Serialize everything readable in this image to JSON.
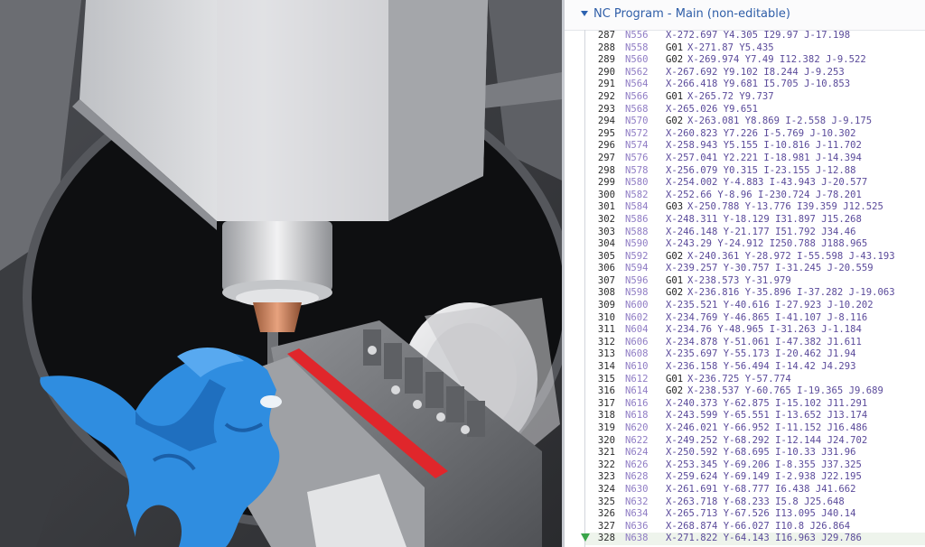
{
  "panel": {
    "title": "NC Program - Main (non-editable)",
    "current_line": "328"
  },
  "colors": {
    "part": "#2f8de0",
    "vise_stripe": "#e0262b",
    "tool_holder": "#c97a52",
    "tool_tip": "#e6c43a",
    "line_number_text": "#2b2b2b",
    "block_number_text": "#8f7cc4",
    "gcode_text": "#222222",
    "coord_text": "#5a4a9a",
    "header_text": "#2f5ea8",
    "current_marker": "#3aa54a"
  },
  "nc_lines": [
    {
      "ln": "287",
      "n": "N556",
      "g": "",
      "rest": "X-272.697 Y4.305 I29.97 J-17.198"
    },
    {
      "ln": "288",
      "n": "N558",
      "g": "G01",
      "rest": "X-271.87 Y5.435"
    },
    {
      "ln": "289",
      "n": "N560",
      "g": "G02",
      "rest": "X-269.974 Y7.49 I12.382 J-9.522"
    },
    {
      "ln": "290",
      "n": "N562",
      "g": "",
      "rest": "X-267.692 Y9.102 I8.244 J-9.253"
    },
    {
      "ln": "291",
      "n": "N564",
      "g": "",
      "rest": "X-266.418 Y9.681 I5.705 J-10.853"
    },
    {
      "ln": "292",
      "n": "N566",
      "g": "G01",
      "rest": "X-265.72 Y9.737"
    },
    {
      "ln": "293",
      "n": "N568",
      "g": "",
      "rest": "X-265.026 Y9.651"
    },
    {
      "ln": "294",
      "n": "N570",
      "g": "G02",
      "rest": "X-263.081 Y8.869 I-2.558 J-9.175"
    },
    {
      "ln": "295",
      "n": "N572",
      "g": "",
      "rest": "X-260.823 Y7.226 I-5.769 J-10.302"
    },
    {
      "ln": "296",
      "n": "N574",
      "g": "",
      "rest": "X-258.943 Y5.155 I-10.816 J-11.702"
    },
    {
      "ln": "297",
      "n": "N576",
      "g": "",
      "rest": "X-257.041 Y2.221 I-18.981 J-14.394"
    },
    {
      "ln": "298",
      "n": "N578",
      "g": "",
      "rest": "X-256.079 Y0.315 I-23.155 J-12.88"
    },
    {
      "ln": "299",
      "n": "N580",
      "g": "",
      "rest": "X-254.002 Y-4.883 I-43.943 J-20.577"
    },
    {
      "ln": "300",
      "n": "N582",
      "g": "",
      "rest": "X-252.66 Y-8.96 I-230.724 J-78.201"
    },
    {
      "ln": "301",
      "n": "N584",
      "g": "G03",
      "rest": "X-250.788 Y-13.776 I39.359 J12.525"
    },
    {
      "ln": "302",
      "n": "N586",
      "g": "",
      "rest": "X-248.311 Y-18.129 I31.897 J15.268"
    },
    {
      "ln": "303",
      "n": "N588",
      "g": "",
      "rest": "X-246.148 Y-21.177 I51.792 J34.46"
    },
    {
      "ln": "304",
      "n": "N590",
      "g": "",
      "rest": "X-243.29 Y-24.912 I250.788 J188.965"
    },
    {
      "ln": "305",
      "n": "N592",
      "g": "G02",
      "rest": "X-240.361 Y-28.972 I-55.598 J-43.193"
    },
    {
      "ln": "306",
      "n": "N594",
      "g": "",
      "rest": "X-239.257 Y-30.757 I-31.245 J-20.559"
    },
    {
      "ln": "307",
      "n": "N596",
      "g": "G01",
      "rest": "X-238.573 Y-31.979"
    },
    {
      "ln": "308",
      "n": "N598",
      "g": "G02",
      "rest": "X-236.816 Y-35.896 I-37.282 J-19.063"
    },
    {
      "ln": "309",
      "n": "N600",
      "g": "",
      "rest": "X-235.521 Y-40.616 I-27.923 J-10.202"
    },
    {
      "ln": "310",
      "n": "N602",
      "g": "",
      "rest": "X-234.769 Y-46.865 I-41.107 J-8.116"
    },
    {
      "ln": "311",
      "n": "N604",
      "g": "",
      "rest": "X-234.76 Y-48.965 I-31.263 J-1.184"
    },
    {
      "ln": "312",
      "n": "N606",
      "g": "",
      "rest": "X-234.878 Y-51.061 I-47.382 J1.611"
    },
    {
      "ln": "313",
      "n": "N608",
      "g": "",
      "rest": "X-235.697 Y-55.173 I-20.462 J1.94"
    },
    {
      "ln": "314",
      "n": "N610",
      "g": "",
      "rest": "X-236.158 Y-56.494 I-14.42 J4.293"
    },
    {
      "ln": "315",
      "n": "N612",
      "g": "G01",
      "rest": "X-236.725 Y-57.774"
    },
    {
      "ln": "316",
      "n": "N614",
      "g": "G02",
      "rest": "X-238.537 Y-60.765 I-19.365 J9.689"
    },
    {
      "ln": "317",
      "n": "N616",
      "g": "",
      "rest": "X-240.373 Y-62.875 I-15.102 J11.291"
    },
    {
      "ln": "318",
      "n": "N618",
      "g": "",
      "rest": "X-243.599 Y-65.551 I-13.652 J13.174"
    },
    {
      "ln": "319",
      "n": "N620",
      "g": "",
      "rest": "X-246.021 Y-66.952 I-11.152 J16.486"
    },
    {
      "ln": "320",
      "n": "N622",
      "g": "",
      "rest": "X-249.252 Y-68.292 I-12.144 J24.702"
    },
    {
      "ln": "321",
      "n": "N624",
      "g": "",
      "rest": "X-250.592 Y-68.695 I-10.33 J31.96"
    },
    {
      "ln": "322",
      "n": "N626",
      "g": "",
      "rest": "X-253.345 Y-69.206 I-8.355 J37.325"
    },
    {
      "ln": "323",
      "n": "N628",
      "g": "",
      "rest": "X-259.624 Y-69.149 I-2.938 J22.195"
    },
    {
      "ln": "324",
      "n": "N630",
      "g": "",
      "rest": "X-261.691 Y-68.777 I6.438 J41.662"
    },
    {
      "ln": "325",
      "n": "N632",
      "g": "",
      "rest": "X-263.718 Y-68.233 I5.8 J25.648"
    },
    {
      "ln": "326",
      "n": "N634",
      "g": "",
      "rest": "X-265.713 Y-67.526 I13.095 J40.14"
    },
    {
      "ln": "327",
      "n": "N636",
      "g": "",
      "rest": "X-268.874 Y-66.027 I10.8 J26.864"
    },
    {
      "ln": "328",
      "n": "N638",
      "g": "",
      "rest": "X-271.822 Y-64.143 I16.963 J29.786"
    }
  ]
}
